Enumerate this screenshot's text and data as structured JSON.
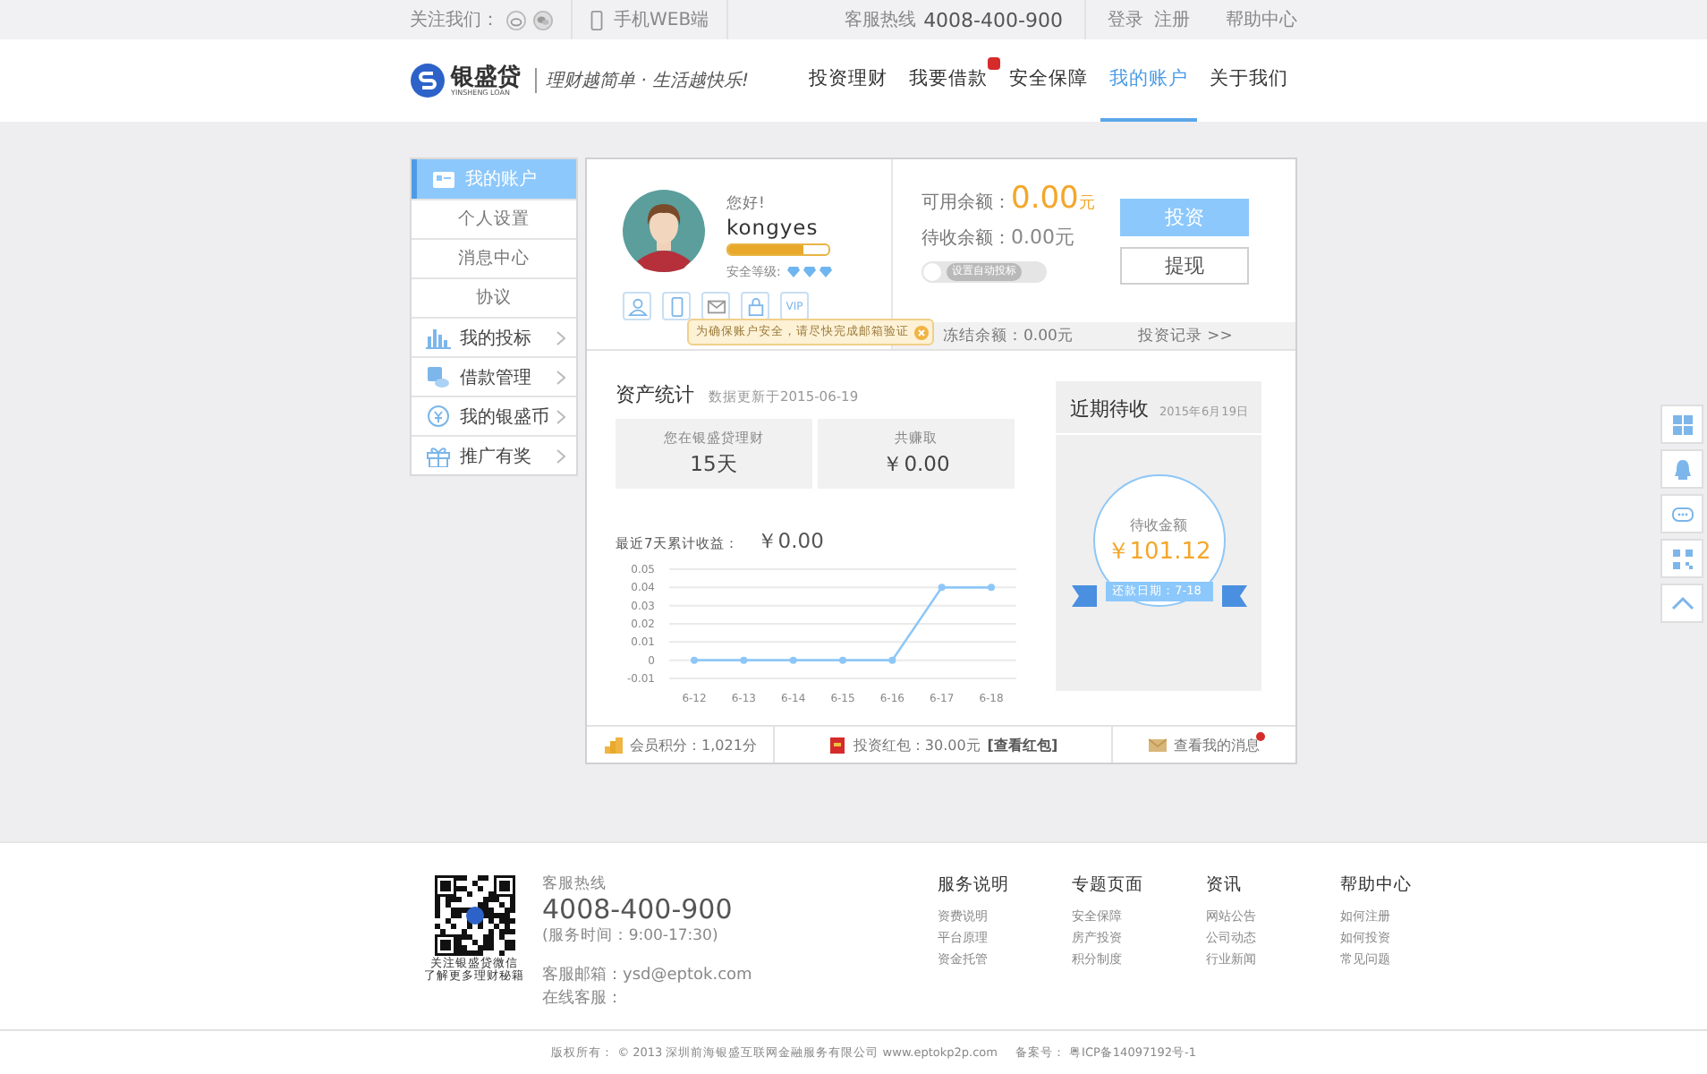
{
  "topbar": {
    "follow_label": "关注我们：",
    "mobile_label": "手机WEB端",
    "hotline_label": "客服热线",
    "hotline": "4008-400-900",
    "links": [
      "登录",
      "注册",
      "帮助中心"
    ]
  },
  "header": {
    "logo_name": "银盛贷",
    "logo_sub": "YINSHENG LOAN",
    "slogan": "理财越简单 · 生活越快乐!",
    "nav": [
      {
        "label": "投资理财",
        "selected": false,
        "badge": false
      },
      {
        "label": "我要借款",
        "selected": false,
        "badge": true
      },
      {
        "label": "安全保障",
        "selected": false,
        "badge": false
      },
      {
        "label": "我的账户",
        "selected": true,
        "badge": false
      },
      {
        "label": "关于我们",
        "selected": false,
        "badge": false
      }
    ]
  },
  "sidebar": {
    "items": [
      {
        "kind": "head",
        "label": "我的账户",
        "selected": true
      },
      {
        "kind": "sub",
        "label": "个人设置",
        "selected": false
      },
      {
        "kind": "sub",
        "label": "消息中心",
        "selected": false
      },
      {
        "kind": "sub",
        "label": "协议",
        "selected": false
      },
      {
        "kind": "item",
        "label": "我的投标",
        "selected": false
      },
      {
        "kind": "item",
        "label": "借款管理",
        "selected": false
      },
      {
        "kind": "item",
        "label": "我的银盛币",
        "selected": false
      },
      {
        "kind": "item",
        "label": "推广有奖",
        "selected": false
      }
    ]
  },
  "profile": {
    "greeting": "您好!",
    "username": "kongyes",
    "security": {
      "level": 0.75
    },
    "security_label": "安全等级:",
    "stars": 3,
    "verify_icons": [
      {
        "kind": "person"
      },
      {
        "kind": "phone"
      },
      {
        "kind": "mail"
      },
      {
        "kind": "lock"
      },
      {
        "kind": "vip",
        "label": "VIP"
      }
    ],
    "tooltip": "为确保账户安全，请尽快完成邮箱验证"
  },
  "balance": {
    "available_label": "可用余额：",
    "available": "0.00",
    "unit": "元",
    "pending_label": "待收余额：",
    "pending": "0.00元",
    "auto_bid": {
      "label": "设置自动投标",
      "on": false
    },
    "buttons": [
      {
        "kind": "primary",
        "label": "投资"
      },
      {
        "kind": "secondary",
        "label": "提现"
      }
    ],
    "frozen": "冻结余额：0.00元",
    "records_link": "投资记录 >>"
  },
  "assets": {
    "title": "资产统计",
    "updated": "数据更新于2015-06-19",
    "stats": [
      {
        "label": "您在银盛贷理财",
        "value": "15天"
      },
      {
        "label": "共赚取",
        "value": "￥0.00"
      }
    ],
    "income_label": "最近7天累计收益：",
    "income": "￥0.00",
    "chart_data": {
      "type": "line",
      "categories": [
        "6-12",
        "6-13",
        "6-14",
        "6-15",
        "6-16",
        "6-17",
        "6-18"
      ],
      "yticks": [
        -0.01,
        0,
        0.01,
        0.02,
        0.03,
        0.04,
        0.05
      ],
      "ylim": [
        -0.01,
        0.05
      ],
      "grid": true,
      "series": [
        {
          "color": "#8ec7f7",
          "marker": true,
          "values": [
            0,
            0,
            0,
            0,
            0,
            0.04,
            0.04
          ]
        }
      ]
    }
  },
  "upcoming": {
    "title": "近期待收",
    "date": "2015年6月19日",
    "amount_label": "待收金额",
    "amount": "￥101.12",
    "repay_date": "还款日期：7-18"
  },
  "bottom": {
    "points": "会员积分：1,021分",
    "redpack": "投资红包：30.00元",
    "redpack_link": "[查看红包]",
    "messages": "查看我的消息",
    "messages_badge": true
  },
  "float_buttons": [
    {
      "kind": "grid"
    },
    {
      "kind": "qq"
    },
    {
      "kind": "chat"
    },
    {
      "kind": "qr"
    },
    {
      "kind": "top"
    }
  ],
  "footer": {
    "qr_caption": [
      "关注银盛贷微信",
      "了解更多理财秘籍"
    ],
    "hotline_label": "客服热线",
    "hotline": "4008-400-900",
    "hours": "(服务时间：9:00-17:30)",
    "email": "客服邮箱：ysd@eptok.com",
    "online": "在线客服：",
    "columns": [
      {
        "title": "服务说明",
        "links": [
          "资费说明",
          "平台原理",
          "资金托管"
        ]
      },
      {
        "title": "专题页面",
        "links": [
          "安全保障",
          "房产投资",
          "积分制度"
        ]
      },
      {
        "title": "资讯",
        "links": [
          "网站公告",
          "公司动态",
          "行业新闻"
        ]
      },
      {
        "title": "帮助中心",
        "links": [
          "如何注册",
          "如何投资",
          "常见问题"
        ]
      }
    ],
    "copyright": "版权所有： © 2013 深圳前海银盛互联网金融服务有限公司 www.eptokp2p.com",
    "icp": "备案号： 粤ICP备14097192号-1"
  }
}
